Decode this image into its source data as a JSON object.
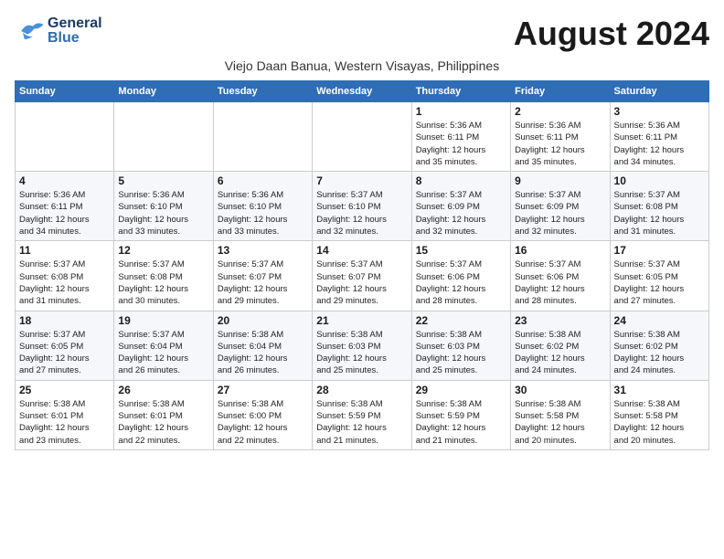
{
  "header": {
    "logo": {
      "line1": "General",
      "line2": "Blue"
    },
    "month": "August 2024",
    "location": "Viejo Daan Banua, Western Visayas, Philippines"
  },
  "days_of_week": [
    "Sunday",
    "Monday",
    "Tuesday",
    "Wednesday",
    "Thursday",
    "Friday",
    "Saturday"
  ],
  "weeks": [
    [
      {
        "day": "",
        "info": ""
      },
      {
        "day": "",
        "info": ""
      },
      {
        "day": "",
        "info": ""
      },
      {
        "day": "",
        "info": ""
      },
      {
        "day": "1",
        "info": "Sunrise: 5:36 AM\nSunset: 6:11 PM\nDaylight: 12 hours\nand 35 minutes."
      },
      {
        "day": "2",
        "info": "Sunrise: 5:36 AM\nSunset: 6:11 PM\nDaylight: 12 hours\nand 35 minutes."
      },
      {
        "day": "3",
        "info": "Sunrise: 5:36 AM\nSunset: 6:11 PM\nDaylight: 12 hours\nand 34 minutes."
      }
    ],
    [
      {
        "day": "4",
        "info": "Sunrise: 5:36 AM\nSunset: 6:11 PM\nDaylight: 12 hours\nand 34 minutes."
      },
      {
        "day": "5",
        "info": "Sunrise: 5:36 AM\nSunset: 6:10 PM\nDaylight: 12 hours\nand 33 minutes."
      },
      {
        "day": "6",
        "info": "Sunrise: 5:36 AM\nSunset: 6:10 PM\nDaylight: 12 hours\nand 33 minutes."
      },
      {
        "day": "7",
        "info": "Sunrise: 5:37 AM\nSunset: 6:10 PM\nDaylight: 12 hours\nand 32 minutes."
      },
      {
        "day": "8",
        "info": "Sunrise: 5:37 AM\nSunset: 6:09 PM\nDaylight: 12 hours\nand 32 minutes."
      },
      {
        "day": "9",
        "info": "Sunrise: 5:37 AM\nSunset: 6:09 PM\nDaylight: 12 hours\nand 32 minutes."
      },
      {
        "day": "10",
        "info": "Sunrise: 5:37 AM\nSunset: 6:08 PM\nDaylight: 12 hours\nand 31 minutes."
      }
    ],
    [
      {
        "day": "11",
        "info": "Sunrise: 5:37 AM\nSunset: 6:08 PM\nDaylight: 12 hours\nand 31 minutes."
      },
      {
        "day": "12",
        "info": "Sunrise: 5:37 AM\nSunset: 6:08 PM\nDaylight: 12 hours\nand 30 minutes."
      },
      {
        "day": "13",
        "info": "Sunrise: 5:37 AM\nSunset: 6:07 PM\nDaylight: 12 hours\nand 29 minutes."
      },
      {
        "day": "14",
        "info": "Sunrise: 5:37 AM\nSunset: 6:07 PM\nDaylight: 12 hours\nand 29 minutes."
      },
      {
        "day": "15",
        "info": "Sunrise: 5:37 AM\nSunset: 6:06 PM\nDaylight: 12 hours\nand 28 minutes."
      },
      {
        "day": "16",
        "info": "Sunrise: 5:37 AM\nSunset: 6:06 PM\nDaylight: 12 hours\nand 28 minutes."
      },
      {
        "day": "17",
        "info": "Sunrise: 5:37 AM\nSunset: 6:05 PM\nDaylight: 12 hours\nand 27 minutes."
      }
    ],
    [
      {
        "day": "18",
        "info": "Sunrise: 5:37 AM\nSunset: 6:05 PM\nDaylight: 12 hours\nand 27 minutes."
      },
      {
        "day": "19",
        "info": "Sunrise: 5:37 AM\nSunset: 6:04 PM\nDaylight: 12 hours\nand 26 minutes."
      },
      {
        "day": "20",
        "info": "Sunrise: 5:38 AM\nSunset: 6:04 PM\nDaylight: 12 hours\nand 26 minutes."
      },
      {
        "day": "21",
        "info": "Sunrise: 5:38 AM\nSunset: 6:03 PM\nDaylight: 12 hours\nand 25 minutes."
      },
      {
        "day": "22",
        "info": "Sunrise: 5:38 AM\nSunset: 6:03 PM\nDaylight: 12 hours\nand 25 minutes."
      },
      {
        "day": "23",
        "info": "Sunrise: 5:38 AM\nSunset: 6:02 PM\nDaylight: 12 hours\nand 24 minutes."
      },
      {
        "day": "24",
        "info": "Sunrise: 5:38 AM\nSunset: 6:02 PM\nDaylight: 12 hours\nand 24 minutes."
      }
    ],
    [
      {
        "day": "25",
        "info": "Sunrise: 5:38 AM\nSunset: 6:01 PM\nDaylight: 12 hours\nand 23 minutes."
      },
      {
        "day": "26",
        "info": "Sunrise: 5:38 AM\nSunset: 6:01 PM\nDaylight: 12 hours\nand 22 minutes."
      },
      {
        "day": "27",
        "info": "Sunrise: 5:38 AM\nSunset: 6:00 PM\nDaylight: 12 hours\nand 22 minutes."
      },
      {
        "day": "28",
        "info": "Sunrise: 5:38 AM\nSunset: 5:59 PM\nDaylight: 12 hours\nand 21 minutes."
      },
      {
        "day": "29",
        "info": "Sunrise: 5:38 AM\nSunset: 5:59 PM\nDaylight: 12 hours\nand 21 minutes."
      },
      {
        "day": "30",
        "info": "Sunrise: 5:38 AM\nSunset: 5:58 PM\nDaylight: 12 hours\nand 20 minutes."
      },
      {
        "day": "31",
        "info": "Sunrise: 5:38 AM\nSunset: 5:58 PM\nDaylight: 12 hours\nand 20 minutes."
      }
    ]
  ]
}
